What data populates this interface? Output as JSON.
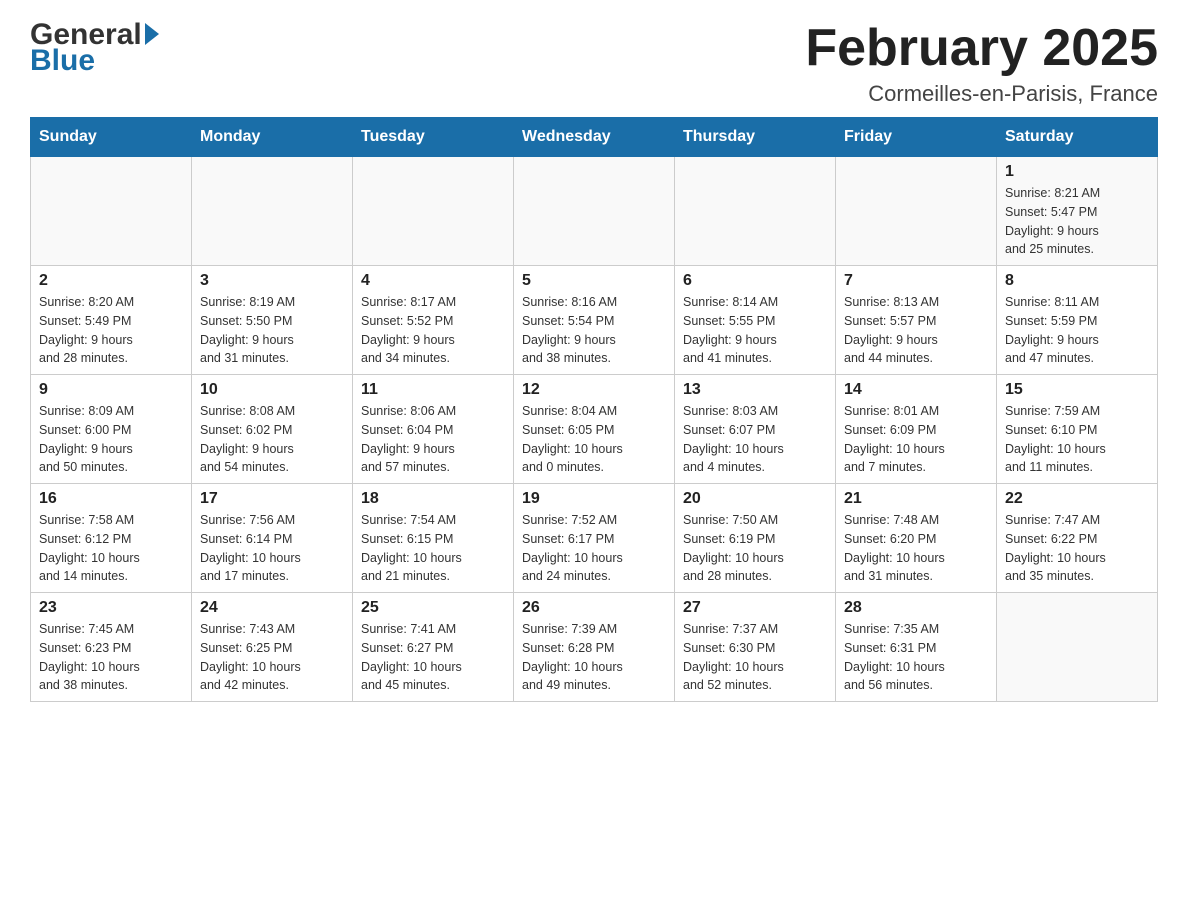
{
  "logo": {
    "general": "General",
    "blue": "Blue",
    "arrow": "▶"
  },
  "header": {
    "title": "February 2025",
    "location": "Cormeilles-en-Parisis, France"
  },
  "weekdays": [
    "Sunday",
    "Monday",
    "Tuesday",
    "Wednesday",
    "Thursday",
    "Friday",
    "Saturday"
  ],
  "weeks": [
    {
      "days": [
        {
          "number": "",
          "info": ""
        },
        {
          "number": "",
          "info": ""
        },
        {
          "number": "",
          "info": ""
        },
        {
          "number": "",
          "info": ""
        },
        {
          "number": "",
          "info": ""
        },
        {
          "number": "",
          "info": ""
        },
        {
          "number": "1",
          "info": "Sunrise: 8:21 AM\nSunset: 5:47 PM\nDaylight: 9 hours\nand 25 minutes."
        }
      ]
    },
    {
      "days": [
        {
          "number": "2",
          "info": "Sunrise: 8:20 AM\nSunset: 5:49 PM\nDaylight: 9 hours\nand 28 minutes."
        },
        {
          "number": "3",
          "info": "Sunrise: 8:19 AM\nSunset: 5:50 PM\nDaylight: 9 hours\nand 31 minutes."
        },
        {
          "number": "4",
          "info": "Sunrise: 8:17 AM\nSunset: 5:52 PM\nDaylight: 9 hours\nand 34 minutes."
        },
        {
          "number": "5",
          "info": "Sunrise: 8:16 AM\nSunset: 5:54 PM\nDaylight: 9 hours\nand 38 minutes."
        },
        {
          "number": "6",
          "info": "Sunrise: 8:14 AM\nSunset: 5:55 PM\nDaylight: 9 hours\nand 41 minutes."
        },
        {
          "number": "7",
          "info": "Sunrise: 8:13 AM\nSunset: 5:57 PM\nDaylight: 9 hours\nand 44 minutes."
        },
        {
          "number": "8",
          "info": "Sunrise: 8:11 AM\nSunset: 5:59 PM\nDaylight: 9 hours\nand 47 minutes."
        }
      ]
    },
    {
      "days": [
        {
          "number": "9",
          "info": "Sunrise: 8:09 AM\nSunset: 6:00 PM\nDaylight: 9 hours\nand 50 minutes."
        },
        {
          "number": "10",
          "info": "Sunrise: 8:08 AM\nSunset: 6:02 PM\nDaylight: 9 hours\nand 54 minutes."
        },
        {
          "number": "11",
          "info": "Sunrise: 8:06 AM\nSunset: 6:04 PM\nDaylight: 9 hours\nand 57 minutes."
        },
        {
          "number": "12",
          "info": "Sunrise: 8:04 AM\nSunset: 6:05 PM\nDaylight: 10 hours\nand 0 minutes."
        },
        {
          "number": "13",
          "info": "Sunrise: 8:03 AM\nSunset: 6:07 PM\nDaylight: 10 hours\nand 4 minutes."
        },
        {
          "number": "14",
          "info": "Sunrise: 8:01 AM\nSunset: 6:09 PM\nDaylight: 10 hours\nand 7 minutes."
        },
        {
          "number": "15",
          "info": "Sunrise: 7:59 AM\nSunset: 6:10 PM\nDaylight: 10 hours\nand 11 minutes."
        }
      ]
    },
    {
      "days": [
        {
          "number": "16",
          "info": "Sunrise: 7:58 AM\nSunset: 6:12 PM\nDaylight: 10 hours\nand 14 minutes."
        },
        {
          "number": "17",
          "info": "Sunrise: 7:56 AM\nSunset: 6:14 PM\nDaylight: 10 hours\nand 17 minutes."
        },
        {
          "number": "18",
          "info": "Sunrise: 7:54 AM\nSunset: 6:15 PM\nDaylight: 10 hours\nand 21 minutes."
        },
        {
          "number": "19",
          "info": "Sunrise: 7:52 AM\nSunset: 6:17 PM\nDaylight: 10 hours\nand 24 minutes."
        },
        {
          "number": "20",
          "info": "Sunrise: 7:50 AM\nSunset: 6:19 PM\nDaylight: 10 hours\nand 28 minutes."
        },
        {
          "number": "21",
          "info": "Sunrise: 7:48 AM\nSunset: 6:20 PM\nDaylight: 10 hours\nand 31 minutes."
        },
        {
          "number": "22",
          "info": "Sunrise: 7:47 AM\nSunset: 6:22 PM\nDaylight: 10 hours\nand 35 minutes."
        }
      ]
    },
    {
      "days": [
        {
          "number": "23",
          "info": "Sunrise: 7:45 AM\nSunset: 6:23 PM\nDaylight: 10 hours\nand 38 minutes."
        },
        {
          "number": "24",
          "info": "Sunrise: 7:43 AM\nSunset: 6:25 PM\nDaylight: 10 hours\nand 42 minutes."
        },
        {
          "number": "25",
          "info": "Sunrise: 7:41 AM\nSunset: 6:27 PM\nDaylight: 10 hours\nand 45 minutes."
        },
        {
          "number": "26",
          "info": "Sunrise: 7:39 AM\nSunset: 6:28 PM\nDaylight: 10 hours\nand 49 minutes."
        },
        {
          "number": "27",
          "info": "Sunrise: 7:37 AM\nSunset: 6:30 PM\nDaylight: 10 hours\nand 52 minutes."
        },
        {
          "number": "28",
          "info": "Sunrise: 7:35 AM\nSunset: 6:31 PM\nDaylight: 10 hours\nand 56 minutes."
        },
        {
          "number": "",
          "info": ""
        }
      ]
    }
  ],
  "colors": {
    "header_bg": "#1a6ea8",
    "header_text": "#ffffff",
    "border": "#cccccc",
    "title_text": "#222222",
    "day_number": "#222222",
    "day_info": "#333333"
  }
}
